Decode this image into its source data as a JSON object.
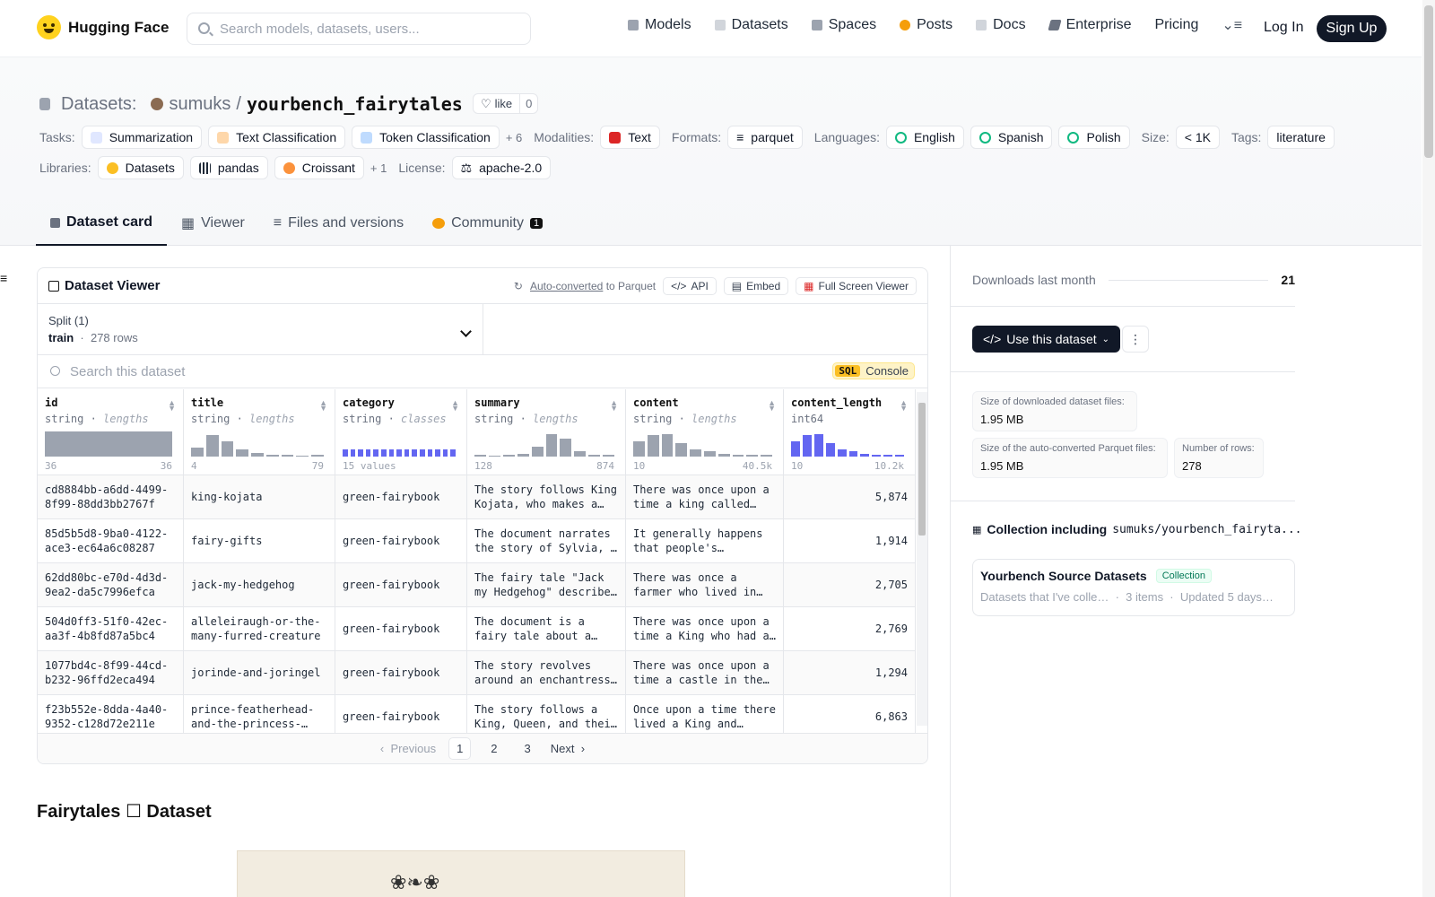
{
  "header": {
    "brand": "Hugging Face",
    "search_placeholder": "Search models, datasets, users...",
    "nav": [
      "Models",
      "Datasets",
      "Spaces",
      "Posts",
      "Docs",
      "Enterprise",
      "Pricing"
    ],
    "login": "Log In",
    "signup": "Sign Up"
  },
  "dataset": {
    "crumb_label": "Datasets:",
    "owner": "sumuks",
    "slash": "/",
    "name": "yourbench_fairytales",
    "like_label": "like",
    "like_count": "0"
  },
  "tags": {
    "tasks_label": "Tasks:",
    "tasks": [
      "Summarization",
      "Text Classification",
      "Token Classification"
    ],
    "tasks_more": "+ 6",
    "modalities_label": "Modalities:",
    "modality": "Text",
    "formats_label": "Formats:",
    "format": "parquet",
    "languages_label": "Languages:",
    "languages": [
      "English",
      "Spanish",
      "Polish"
    ],
    "size_label": "Size:",
    "size": "< 1K",
    "tags_label": "Tags:",
    "tag": "literature",
    "libraries_label": "Libraries:",
    "libraries": [
      "Datasets",
      "pandas",
      "Croissant"
    ],
    "libraries_more": "+ 1",
    "license_label": "License:",
    "license": "apache-2.0"
  },
  "tabs": [
    "Dataset card",
    "Viewer",
    "Files and versions",
    "Community"
  ],
  "community_count": "1",
  "viewer": {
    "title": "Dataset Viewer",
    "auto_converted": "Auto-converted",
    "to_parquet": "to Parquet",
    "api": "API",
    "embed": "Embed",
    "full_screen": "Full Screen Viewer",
    "split_label": "Split (1)",
    "split_name": "train",
    "split_rows": "278 rows",
    "search_placeholder": "Search this dataset",
    "sql": "SQL",
    "console": "Console",
    "columns": [
      {
        "name": "id",
        "type": "string",
        "stat": "lengths",
        "min": "36",
        "max": "36",
        "hist": [
          1
        ],
        "blue": false
      },
      {
        "name": "title",
        "type": "string",
        "stat": "lengths",
        "min": "4",
        "max": "79",
        "hist": [
          0.35,
          0.85,
          0.6,
          0.3,
          0.15,
          0.08,
          0.05,
          0,
          0.03
        ],
        "blue": false
      },
      {
        "name": "category",
        "type": "string",
        "stat": "classes",
        "min": "15 values",
        "max": "",
        "hist": [],
        "blue": true
      },
      {
        "name": "summary",
        "type": "string",
        "stat": "lengths",
        "min": "128",
        "max": "874",
        "hist": [
          0.03,
          0,
          0.05,
          0.1,
          0.4,
          0.9,
          0.7,
          0.2,
          0.08,
          0.03
        ],
        "blue": false
      },
      {
        "name": "content",
        "type": "string",
        "stat": "lengths",
        "min": "10",
        "max": "40.5k",
        "hist": [
          0.6,
          0.85,
          0.9,
          0.55,
          0.3,
          0.2,
          0.12,
          0.06,
          0.04,
          0.03
        ],
        "blue": false
      },
      {
        "name": "content_length",
        "type": "int64",
        "stat": "",
        "min": "10",
        "max": "10.2k",
        "hist": [
          0.6,
          0.85,
          0.9,
          0.55,
          0.3,
          0.2,
          0.12,
          0.06,
          0.04,
          0.03
        ],
        "blue": true
      }
    ],
    "rows": [
      [
        "cd8884bb-a6dd-4499-8f99-88dd3bb2767f",
        "king-kojata",
        "green-fairybook",
        "The story follows King Kojata, who makes a…",
        "There was once upon a time a king called…",
        "5,874"
      ],
      [
        "85d5b5d8-9ba0-4122-ace3-ec64a6c08287",
        "fairy-gifts",
        "green-fairybook",
        "The document narrates the story of Sylvia, …",
        "It generally happens that people's…",
        "1,914"
      ],
      [
        "62dd80bc-e70d-4d3d-9ea2-da5c7996efca",
        "jack-my-hedgehog",
        "green-fairybook",
        "The fairy tale \"Jack my Hedgehog\" describe…",
        "There was once a farmer who lived in…",
        "2,705"
      ],
      [
        "504d0ff3-51f0-42ec-aa3f-4b8fd87a5bc4",
        "alleleiraugh-or-the-many-furred-creature",
        "green-fairybook",
        "The document is a fairy tale about a…",
        "There was once upon a time a King who had a…",
        "2,769"
      ],
      [
        "1077bd4c-8f99-44cd-b232-96ffd2eca494",
        "jorinde-and-joringel",
        "green-fairybook",
        "The story revolves around an enchantress…",
        "There was once upon a time a castle in the…",
        "1,294"
      ],
      [
        "f23b552e-8dda-4a40-9352-c128d72e211e",
        "prince-featherhead-and-the-princess-…",
        "green-fairybook",
        "The story follows a King, Queen, and thei…",
        "Once upon a time there lived a King and…",
        "6,863"
      ]
    ],
    "pager": {
      "prev": "Previous",
      "pages": [
        "1",
        "2",
        "3"
      ],
      "next": "Next"
    }
  },
  "card": {
    "heading": "Fairytales ☐ Dataset"
  },
  "sidebar": {
    "downloads_label": "Downloads last month",
    "downloads_value": "21",
    "use_button": "Use this dataset",
    "size_dl_label": "Size of downloaded dataset files:",
    "size_dl_value": "1.95 MB",
    "size_pq_label": "Size of the auto-converted Parquet files:",
    "size_pq_value": "1.95 MB",
    "rows_label": "Number of rows:",
    "rows_value": "278",
    "collection_label": "Collection including",
    "collection_repo": "sumuks/yourbench_fairyta...",
    "collection_name": "Yourbench Source Datasets",
    "collection_pill": "Collection",
    "collection_desc": "Datasets that I've colle…",
    "collection_items": "3 items",
    "collection_updated": "Updated 5 days…"
  }
}
